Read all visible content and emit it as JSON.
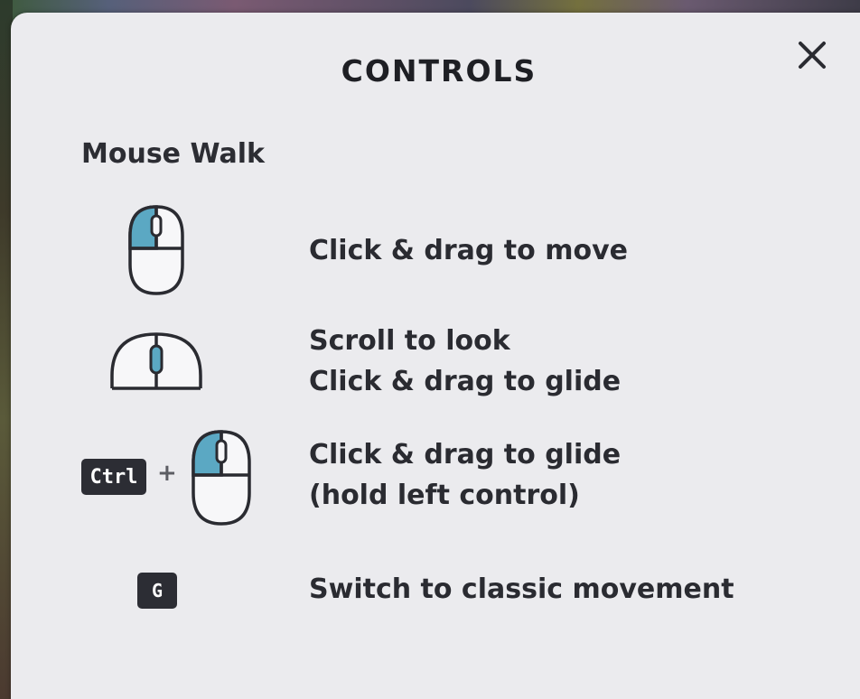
{
  "dialog": {
    "title": "CONTROLS",
    "close_icon": "close-icon"
  },
  "section": {
    "heading": "Mouse Walk"
  },
  "rows": [
    {
      "icon": "mouse-left-button-icon",
      "lines": [
        "Click & drag to move"
      ]
    },
    {
      "icon": "mouse-scroll-wheel-icon",
      "lines": [
        "Scroll to look",
        "Click & drag to glide"
      ]
    },
    {
      "icon": "ctrl-plus-mouse-left-icon",
      "key": "Ctrl",
      "plus": "+",
      "lines": [
        "Click & drag to glide",
        "(hold left control)"
      ]
    },
    {
      "icon": "g-key-icon",
      "key": "G",
      "lines": [
        "Switch to classic movement"
      ]
    }
  ],
  "colors": {
    "panel_bg": "#ebebee",
    "accent_button": "#5ba8c3",
    "text": "#2a2b31",
    "key_bg": "#2c2d34"
  }
}
